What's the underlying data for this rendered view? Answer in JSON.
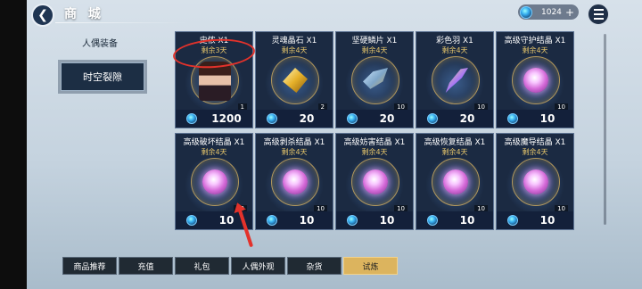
{
  "header": {
    "title": "商 城",
    "currency_amount": "1024",
    "plus": "+"
  },
  "side_nav": {
    "section_label": "人偶装备",
    "selected_item": "时空裂隙"
  },
  "products": [
    {
      "name": "史侬 X1",
      "remain": "剩余3天",
      "qty": "1",
      "price": "1200",
      "art": "portrait"
    },
    {
      "name": "灵魂晶石 X1",
      "remain": "剩余4天",
      "qty": "2",
      "price": "20",
      "art": "gold-crystal"
    },
    {
      "name": "坚硬鳞片 X1",
      "remain": "剩余4天",
      "qty": "10",
      "price": "20",
      "art": "scale"
    },
    {
      "name": "彩色羽 X1",
      "remain": "剩余4天",
      "qty": "10",
      "price": "20",
      "art": "feather"
    },
    {
      "name": "高级守护结晶 X1",
      "remain": "剩余4天",
      "qty": "10",
      "price": "10",
      "art": "pink-crystal"
    },
    {
      "name": "高级破坏结晶 X1",
      "remain": "剩余4天",
      "qty": "10",
      "price": "10",
      "art": "pink-crystal"
    },
    {
      "name": "高级剥杀结晶 X1",
      "remain": "剩余4天",
      "qty": "10",
      "price": "10",
      "art": "pink-crystal"
    },
    {
      "name": "高级妨害结晶 X1",
      "remain": "剩余4天",
      "qty": "10",
      "price": "10",
      "art": "pink-crystal"
    },
    {
      "name": "高级恢复结晶 X1",
      "remain": "剩余4天",
      "qty": "10",
      "price": "10",
      "art": "pink-crystal"
    },
    {
      "name": "高级魔导结晶 X1",
      "remain": "剩余4天",
      "qty": "10",
      "price": "10",
      "art": "pink-crystal"
    }
  ],
  "tabs": [
    {
      "label": "商品推荐",
      "active": false
    },
    {
      "label": "充值",
      "active": false
    },
    {
      "label": "礼包",
      "active": false
    },
    {
      "label": "人偶外观",
      "active": false
    },
    {
      "label": "杂货",
      "active": false
    },
    {
      "label": "试炼",
      "active": true
    }
  ],
  "colors": {
    "accent_gold": "#dcb45e",
    "annotation_red": "#e3322b",
    "card_bg": "#1b2a42"
  }
}
